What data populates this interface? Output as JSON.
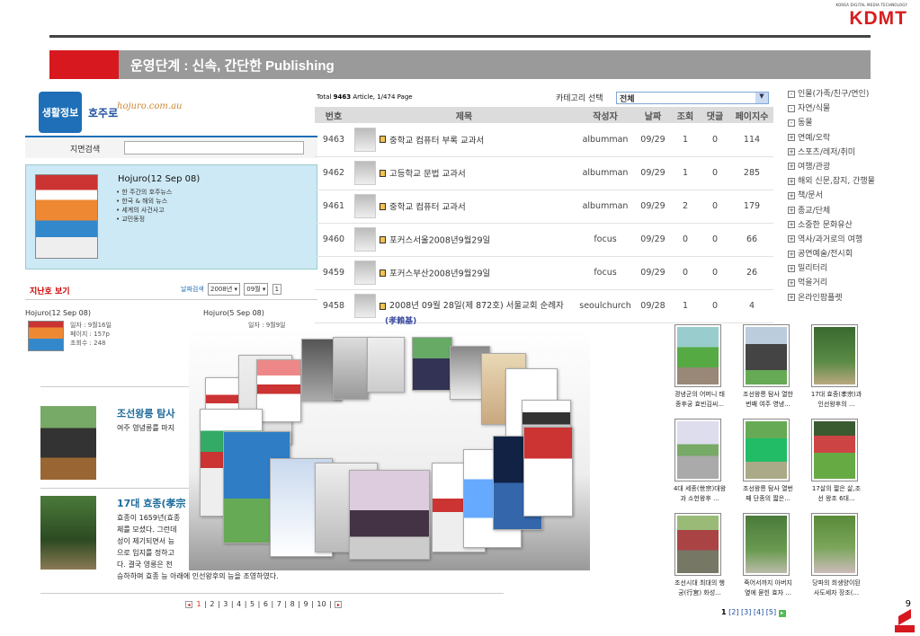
{
  "brand": {
    "tagline": "KOREA DIGITAL MEDIA TECHNOLOGY",
    "name": "KDMT"
  },
  "slide_title": "운영단계 : 신속, 간단한 Publishing",
  "slide_number": "9",
  "left_panel": {
    "logo_text": "생활정보",
    "site_name": "호주로",
    "site_domain": "hojuro.com.au",
    "search_label": "지면검색",
    "feature": {
      "title": "Hojuro(12 Sep 08)",
      "bullets": [
        "한 주간의 호주뉴스",
        "한국 & 해외 뉴스",
        "세계의 사건사고",
        "교민동정"
      ]
    },
    "past_issues_label": "지난호 보기",
    "date_search_label": "날짜검색",
    "year": "2008년",
    "month": "09월",
    "day": "1",
    "issues": [
      {
        "title": "Hojuro(12 Sep 08)",
        "date": "일자 : 9월16일",
        "pages": "페이지 : 157p",
        "views": "조회수 : 248"
      },
      {
        "title": "Hojuro(5 Sep 08)",
        "date": "일자 : 9월9일"
      }
    ]
  },
  "articles": [
    {
      "title": "조선왕릉 탐사",
      "body": [
        "여주 영녕릉를 마지"
      ]
    },
    {
      "title": "17대 효종(孝宗",
      "body": [
        "효종이 1659년(효종",
        "체를 모셨다. 그런데",
        "성이 제기되면서 능",
        "으로 입지를 정하고",
        "다. 결국 영릉은 천",
        "승하하며 효종 능 아래에 인선왕후의 능을 조영하였다."
      ]
    }
  ],
  "article_pager": [
    "1",
    "2",
    "3",
    "4",
    "5",
    "6",
    "7",
    "8",
    "9",
    "10"
  ],
  "board": {
    "total_prefix": "Total",
    "total_count": "9463",
    "total_suffix": "Article, 1/474 Page",
    "category_label": "카테고리 선택",
    "category_value": "전체",
    "columns": [
      "번호",
      "제목",
      "작성자",
      "날짜",
      "조회",
      "댓글",
      "페이지수"
    ],
    "rows": [
      {
        "no": "9463",
        "title": "중학교 컴퓨터 부록 교과서",
        "author": "albumman",
        "date": "09/29",
        "views": "1",
        "comments": "0",
        "pages": "114"
      },
      {
        "no": "9462",
        "title": "고등학교 문법 교과서",
        "author": "albumman",
        "date": "09/29",
        "views": "1",
        "comments": "0",
        "pages": "285"
      },
      {
        "no": "9461",
        "title": "중학교 컴퓨터 교과서",
        "author": "albumman",
        "date": "09/29",
        "views": "2",
        "comments": "0",
        "pages": "179"
      },
      {
        "no": "9460",
        "title": "포커스서울2008년9월29일",
        "author": "focus",
        "date": "09/29",
        "views": "0",
        "comments": "0",
        "pages": "66"
      },
      {
        "no": "9459",
        "title": "포커스부산2008년9월29일",
        "author": "focus",
        "date": "09/29",
        "views": "0",
        "comments": "0",
        "pages": "26"
      },
      {
        "no": "9458",
        "title": "2008년 09월 28일(제 872호) 서울교회 순례자",
        "author": "seoulchurch",
        "date": "09/28",
        "views": "1",
        "comments": "0",
        "pages": "4"
      }
    ]
  },
  "categories": [
    {
      "label": "인물(가족/친구/연인)",
      "mark": "-"
    },
    {
      "label": "자연/식물",
      "mark": "-"
    },
    {
      "label": "동물",
      "mark": "-"
    },
    {
      "label": "연예/오락",
      "mark": "+"
    },
    {
      "label": "스포츠/레저/취미",
      "mark": "+"
    },
    {
      "label": "여행/관광",
      "mark": "+"
    },
    {
      "label": "해외 신문,잡지, 간행물",
      "mark": "+"
    },
    {
      "label": "책/문서",
      "mark": "+"
    },
    {
      "label": "종교/단체",
      "mark": "+"
    },
    {
      "label": "소중한 문화유산",
      "mark": "+"
    },
    {
      "label": "역사/과거로의 여행",
      "mark": "+"
    },
    {
      "label": "공연예술/전시회",
      "mark": "+"
    },
    {
      "label": "밀리터리",
      "mark": "+"
    },
    {
      "label": "먹을거리",
      "mark": "+"
    },
    {
      "label": "온라인팜플렛",
      "mark": "+"
    }
  ],
  "overlay_label": "(孝賴基)",
  "photos": [
    {
      "cap1": "경녕군의 어머니 태",
      "cap2": "종후궁 효빈김씨..."
    },
    {
      "cap1": "조선왕릉 탐사 열한",
      "cap2": "번째 여주 영녕..."
    },
    {
      "cap1": "17대 효종(孝宗)과",
      "cap2": "인선왕후의 ..."
    },
    {
      "cap1": "4대 세종(世宗)대왕",
      "cap2": "과 소헌왕후 ..."
    },
    {
      "cap1": "조선왕릉 탐사 열번",
      "cap2": "째 단종의 짧은..."
    },
    {
      "cap1": "17살의 짧은 삶,조",
      "cap2": "선 왕조 6대..."
    },
    {
      "cap1": "조선시대 최대의 행",
      "cap2": "궁(行宮) 화성..."
    },
    {
      "cap1": "죽어서까지 아버지",
      "cap2": "옆에 묻힌 효자 ..."
    },
    {
      "cap1": "당파의 희생양이된",
      "cap2": "사도세자 장조(..."
    }
  ],
  "photo_pager": {
    "current": "1",
    "pages": [
      "[2]",
      "[3]",
      "[4]",
      "[5]"
    ]
  },
  "colors": {
    "accent_red": "#d7181f",
    "title_gray": "#9a9a9a",
    "link_blue": "#1e6fb7"
  }
}
